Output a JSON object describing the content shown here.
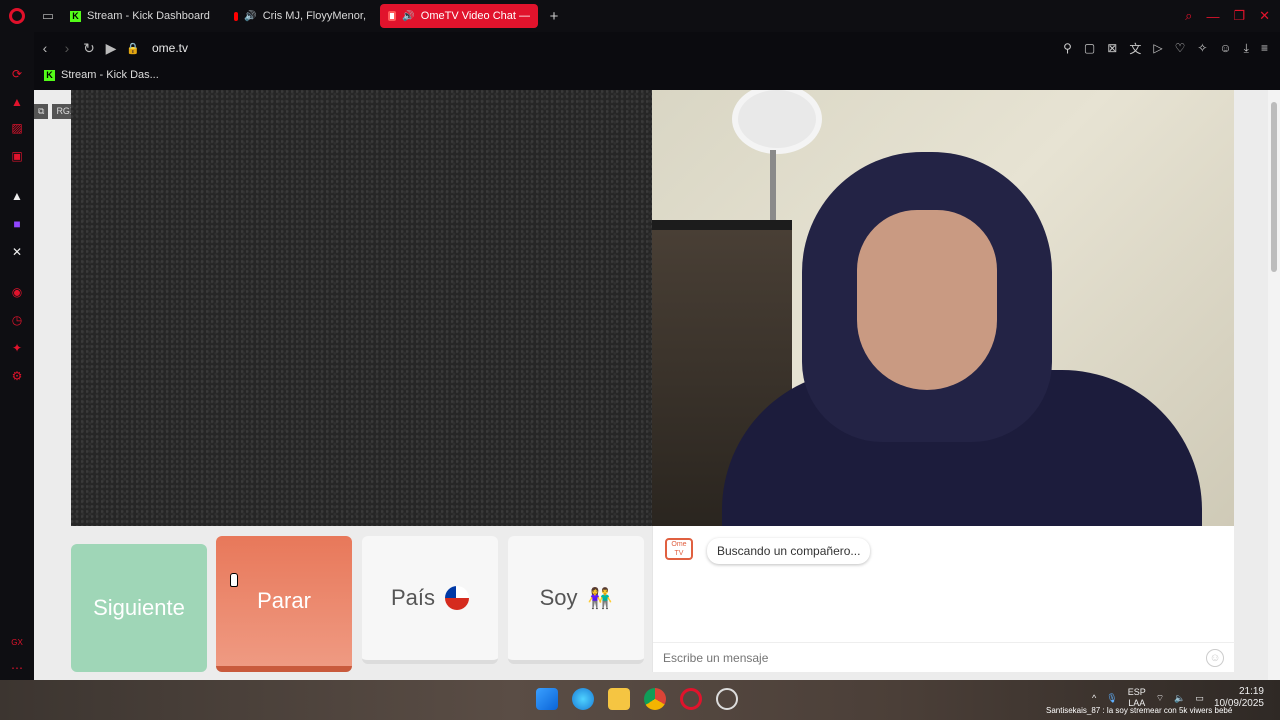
{
  "tabs": [
    {
      "label": "Stream - Kick Dashboard"
    },
    {
      "label": "Cris MJ, FloyyMenor,"
    },
    {
      "label": "OmeTV Video Chat —"
    }
  ],
  "address": {
    "url": "ome.tv"
  },
  "bookmark": {
    "label": "Stream - Kick Das..."
  },
  "extension_badges": {
    "rgx": "RGX"
  },
  "controls": {
    "next_label": "Siguiente",
    "stop_label": "Parar",
    "country_label": "País",
    "gender_label": "Soy"
  },
  "chat": {
    "logo_text": "Ome TV",
    "status": "Buscando un compañero...",
    "placeholder": "Escribe un mensaje"
  },
  "sidebar": {
    "gx_label": "GX"
  },
  "taskbar": {
    "lang_top": "ESP",
    "lang_bottom": "LAA",
    "time": "21:19",
    "date": "10/09/2025",
    "overlay": "Santisekais_87 : la soy stremear con 5k viwers bebé"
  },
  "colors": {
    "accent": "#e1132c",
    "next": "#9fd6b7",
    "stop": "#ec8a6c"
  }
}
